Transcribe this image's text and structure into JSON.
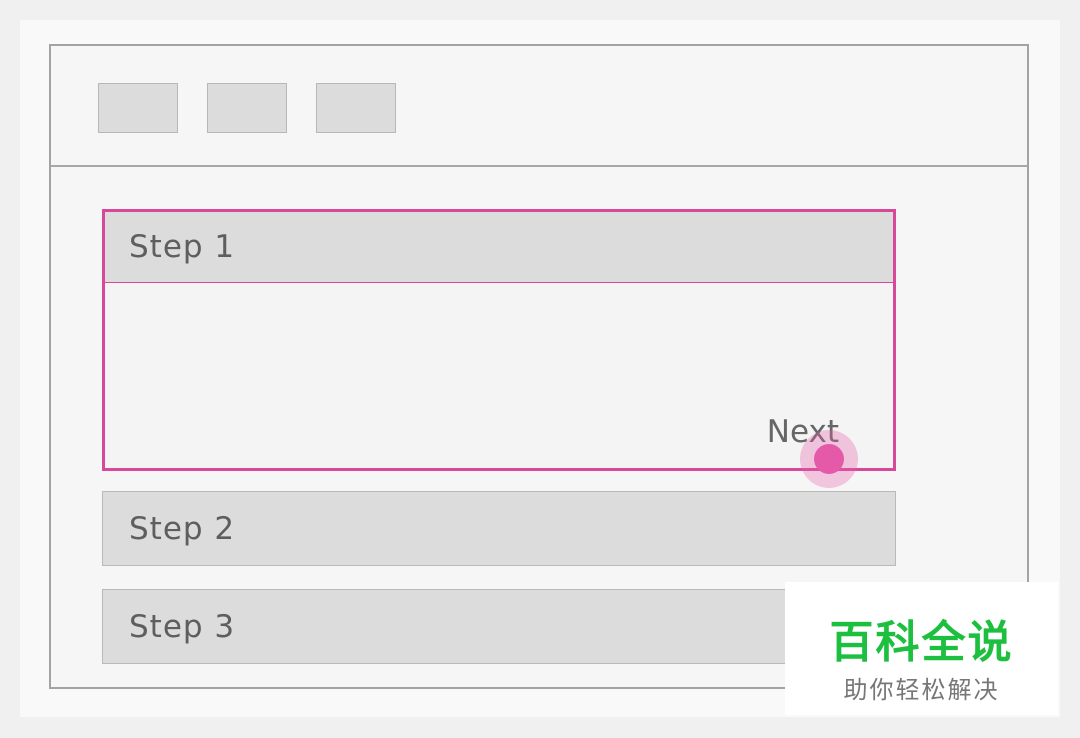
{
  "toolbar": {
    "buttons": [
      "",
      "",
      ""
    ]
  },
  "steps": [
    {
      "label": "Step 1",
      "expanded": true
    },
    {
      "label": "Step 2",
      "expanded": false
    },
    {
      "label": "Step 3",
      "expanded": false
    }
  ],
  "step1_panel": {
    "next_label": "Next"
  },
  "colors": {
    "accent": "#d8489a",
    "tap_indicator": "#e45aa9",
    "header_fill": "#dcdcdc",
    "watermark_green": "#1dbf3f"
  },
  "watermark": {
    "title": "百科全说",
    "subtitle": "助你轻松解决"
  }
}
